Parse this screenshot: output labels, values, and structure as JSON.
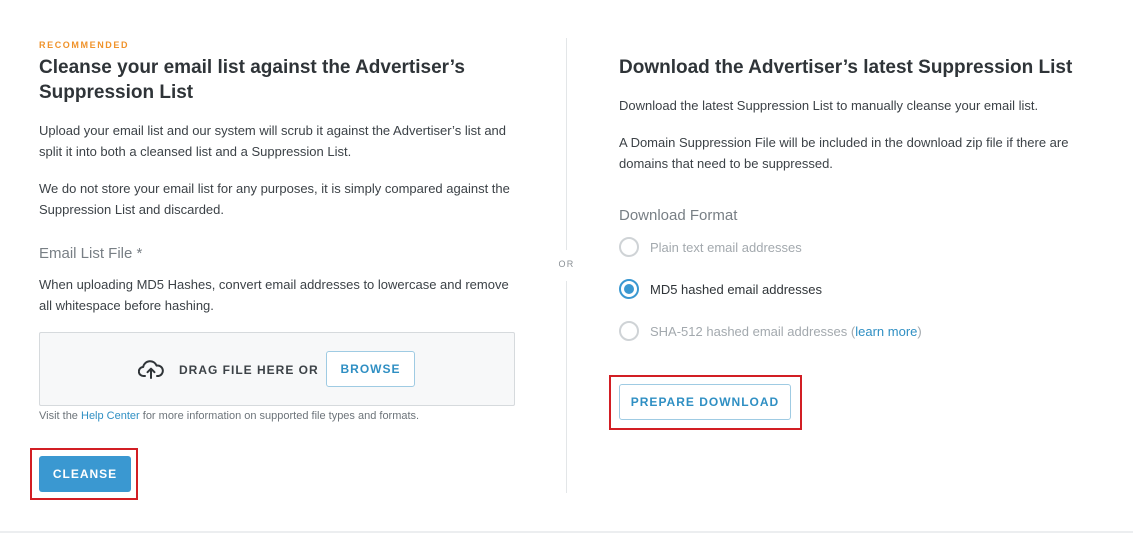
{
  "left": {
    "badge": "RECOMMENDED",
    "title": "Cleanse your email list against the Advertiser’s Suppression List",
    "para1": "Upload your email list and our system will scrub it against the Advertiser’s list and split it into both a cleansed list and a Suppression List.",
    "para2": "We do not store your email list for any purposes, it is simply compared against the Suppression List and discarded.",
    "file_label": "Email List File *",
    "file_hint": "When uploading MD5 Hashes, convert email addresses to lowercase and remove all whitespace before hashing.",
    "dropzone": {
      "text": "DRAG FILE HERE OR",
      "browse_label": "BROWSE",
      "icon": "cloud-upload-icon"
    },
    "help": {
      "prefix": "Visit the ",
      "link": "Help Center",
      "suffix": " for more information on supported file types and formats."
    },
    "cleanse_label": "CLEANSE"
  },
  "divider": {
    "or_label": "OR"
  },
  "right": {
    "title": "Download the Advertiser’s latest Suppression List",
    "para1": "Download the latest Suppression List to manually cleanse your email list.",
    "para2": "A Domain Suppression File will be included in the download zip file if there are domains that need to be suppressed.",
    "format_label": "Download Format",
    "options": [
      {
        "label": "Plain text email addresses",
        "selected": false
      },
      {
        "label": "MD5 hashed email addresses",
        "selected": true
      },
      {
        "label": "SHA-512 hashed email addresses",
        "selected": false,
        "link_open": " (",
        "link": "learn more",
        "link_close": ")"
      }
    ],
    "prepare_label": "PREPARE DOWNLOAD"
  },
  "colors": {
    "accent": "#3a98d1",
    "badge": "#f0932b",
    "highlight": "#d21e24"
  }
}
